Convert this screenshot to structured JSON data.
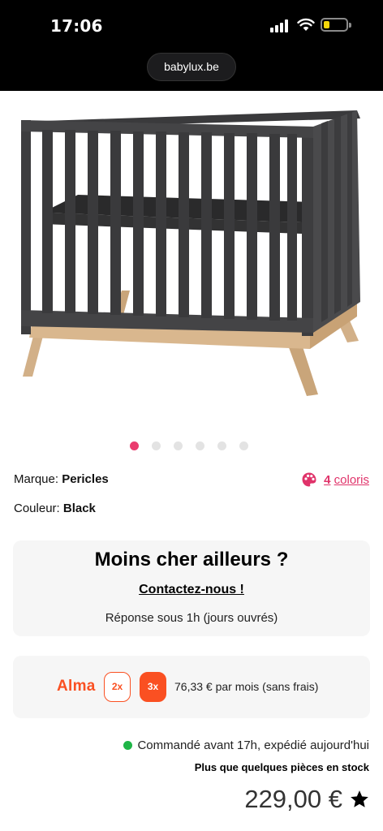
{
  "status_bar": {
    "time": "17:06",
    "battery_color": "#f5d60a",
    "battery_level": 0.2
  },
  "browser": {
    "url": "babylux.be"
  },
  "product": {
    "image_icon": "crib-image",
    "carousel": {
      "count": 6,
      "active_index": 0,
      "active_color": "#ea3b6e"
    },
    "brand_label": "Marque:",
    "brand_value": "Pericles",
    "color_label": "Couleur:",
    "color_value": "Black",
    "colors_link": {
      "icon": "palette-icon",
      "count": "4",
      "label": "coloris"
    }
  },
  "cheaper": {
    "title": "Moins cher ailleurs ?",
    "link": "Contactez-nous !",
    "subtitle": "Réponse sous 1h (jours ouvrés)"
  },
  "alma": {
    "logo": "Alma",
    "option_2x": "2x",
    "option_3x": "3x",
    "selected": "3x",
    "text": "76,33 € par mois (sans frais)",
    "brand_color": "#fa5022"
  },
  "shipping": {
    "text": "Commandé avant 17h, expédié aujourd'hui",
    "status_color": "#1fb547",
    "stock": "Plus que quelques pièces en stock"
  },
  "price": {
    "value": "229,00 €",
    "favorite_icon": "star-icon"
  }
}
